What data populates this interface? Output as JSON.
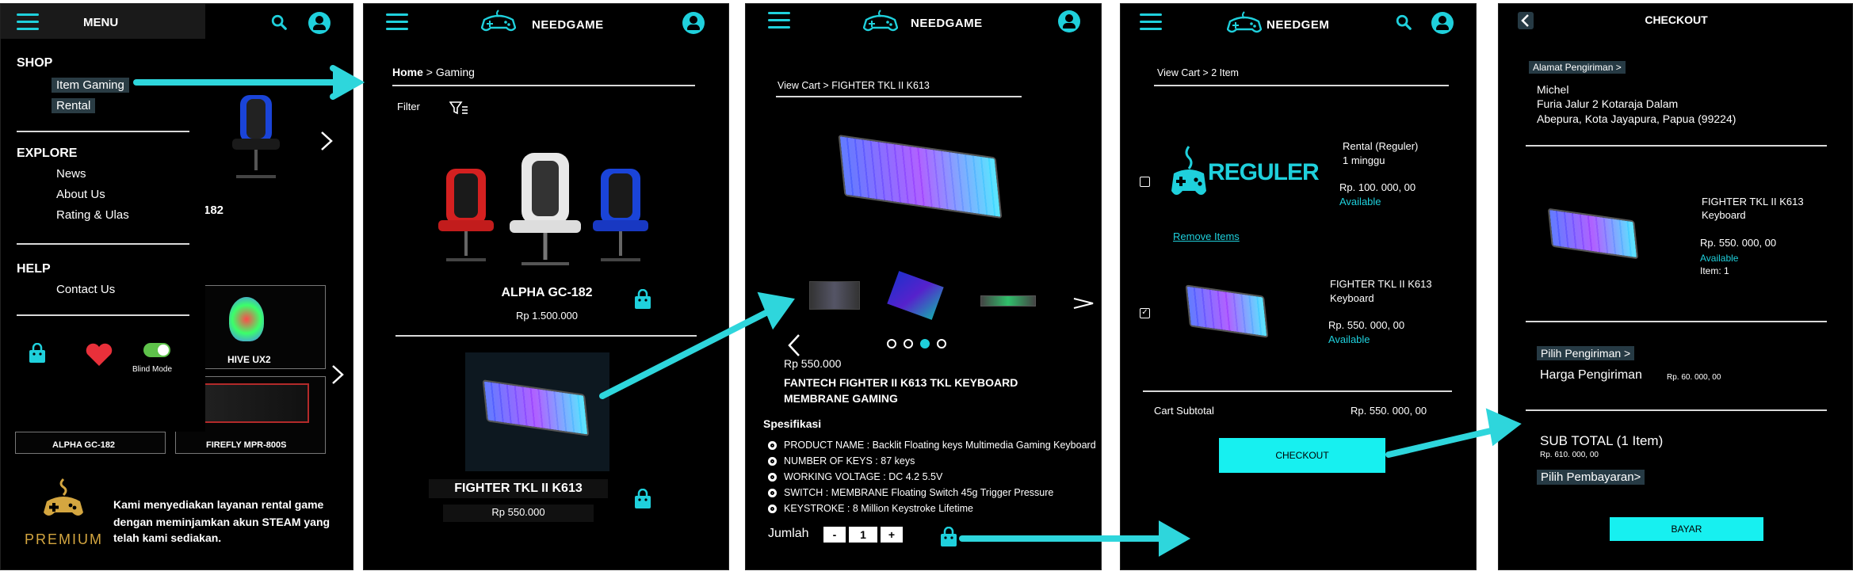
{
  "screen1": {
    "menu_title": "MENU",
    "behind_title": "M",
    "shop_title": "SHOP",
    "shop_items": [
      "Item Gaming",
      "Rental"
    ],
    "explore_title": "EXPLORE",
    "explore_items": [
      "News",
      "About Us",
      "Rating & Ulas"
    ],
    "help_title": "HELP",
    "help_items": [
      "Contact Us"
    ],
    "blind_mode": "Blind Mode",
    "bg_product_name": "182",
    "bg_card1": "HIVE UX2",
    "bg_card2_left": "ALPHA GC-182",
    "bg_card2_right": "FIREFLY MPR-800S",
    "premium_label": "PREMIUM",
    "premium_text": [
      "Kami menyediakan layanan rental game",
      "dengan meminjamkan akun STEAM yang",
      "telah kami sediakan."
    ]
  },
  "screen2": {
    "brand": "NEEDGAME",
    "breadcrumb_home": "Home",
    "breadcrumb_sep": ">",
    "breadcrumb_current": "Gaming",
    "filter_label": "Filter",
    "product1_name": "ALPHA GC-182",
    "product1_price": "Rp 1.500.000",
    "product2_name": "FIGHTER TKL II K613",
    "product2_price": "Rp 550.000"
  },
  "screen3": {
    "brand": "NEEDGAME",
    "breadcrumb": "View Cart  >  FIGHTER TKL II K613",
    "price": "Rp 550.000",
    "title_line1": "FANTECH FIGHTER II K613 TKL KEYBOARD",
    "title_line2": "MEMBRANE GAMING",
    "spec_title": "Spesifikasi",
    "specs": [
      "PRODUCT NAME : Backlit Floating keys Multimedia Gaming Keyboard",
      "NUMBER OF KEYS : 87 keys",
      "WORKING VOLTAGE : DC 4.2 5.5V",
      "SWITCH : MEMBRANE Floating Switch 45g Trigger Pressure",
      "KEYSTROKE : 8 Million Keystroke Lifetime"
    ],
    "qty_label": "Jumlah",
    "qty_minus": "-",
    "qty_value": "1",
    "qty_plus": "+"
  },
  "screen4": {
    "brand": "NEEDGEM",
    "breadcrumb": "View Cart  >  2 Item",
    "reguler_logo_text": "REGULER",
    "item1_name": "Rental (Reguler)",
    "item1_sub": "1 minggu",
    "item1_price": "Rp. 100. 000, 00",
    "item1_status": "Available",
    "remove_items": "Remove Items",
    "item2_name": "FIGHTER TKL II K613",
    "item2_sub": "Keyboard",
    "item2_price": "Rp. 550. 000, 00",
    "item2_status": "Available",
    "checkmark": "✓",
    "subtotal_label": "Cart Subtotal",
    "subtotal_value": "Rp. 550. 000, 00",
    "checkout_button": "CHECKOUT"
  },
  "screen5": {
    "title": "CHECKOUT",
    "address_label": "Alamat Pengiriman >",
    "address_lines": [
      "Michel",
      "Furia Jalur 2 Kotaraja Dalam",
      "Abepura, Kota Jayapura, Papua (99224)"
    ],
    "item_name": "FIGHTER TKL II K613",
    "item_sub": "Keyboard",
    "item_price": "Rp. 550. 000, 00",
    "item_status": "Available",
    "item_qty": "Item: 1",
    "shipping_label": "Pilih Pengiriman >",
    "shipping_price_label": "Harga Pengiriman",
    "shipping_price": "Rp. 60. 000, 00",
    "subtotal_label": "SUB TOTAL (1 Item)",
    "subtotal_value": "Rp. 610. 000, 00",
    "payment_label": "Pilih Pembayaran>",
    "pay_button": "BAYAR"
  },
  "colors": {
    "accent": "#1fd0dc",
    "button": "#17f0f0",
    "background": "#000000",
    "premium_gold": "#d4a640"
  },
  "icons": [
    "menu-icon",
    "gamepad-icon",
    "search-icon",
    "user-icon",
    "filter-icon",
    "shopping-bag-icon",
    "heart-icon",
    "back-icon",
    "chevron-right-icon",
    "chevron-left-icon"
  ]
}
